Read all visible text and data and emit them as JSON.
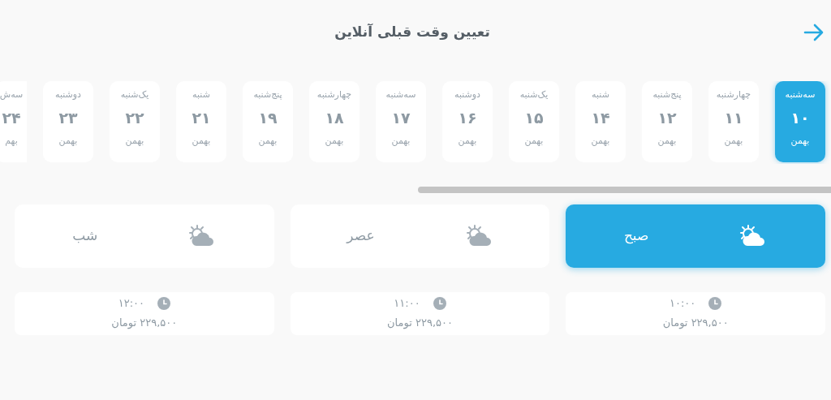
{
  "header": {
    "title": "تعیین وقت قبلی آنلاین"
  },
  "days": [
    {
      "weekday": "سه‌شنبه",
      "day": "۱۰",
      "month": "بهمن",
      "selected": true
    },
    {
      "weekday": "چهارشنبه",
      "day": "۱۱",
      "month": "بهمن",
      "selected": false
    },
    {
      "weekday": "پنج‌شنبه",
      "day": "۱۲",
      "month": "بهمن",
      "selected": false
    },
    {
      "weekday": "شنبه",
      "day": "۱۴",
      "month": "بهمن",
      "selected": false
    },
    {
      "weekday": "یک‌شنبه",
      "day": "۱۵",
      "month": "بهمن",
      "selected": false
    },
    {
      "weekday": "دوشنبه",
      "day": "۱۶",
      "month": "بهمن",
      "selected": false
    },
    {
      "weekday": "سه‌شنبه",
      "day": "۱۷",
      "month": "بهمن",
      "selected": false
    },
    {
      "weekday": "چهارشنبه",
      "day": "۱۸",
      "month": "بهمن",
      "selected": false
    },
    {
      "weekday": "پنج‌شنبه",
      "day": "۱۹",
      "month": "بهمن",
      "selected": false
    },
    {
      "weekday": "شنبه",
      "day": "۲۱",
      "month": "بهمن",
      "selected": false
    },
    {
      "weekday": "یک‌شنبه",
      "day": "۲۲",
      "month": "بهمن",
      "selected": false
    },
    {
      "weekday": "دوشنبه",
      "day": "۲۳",
      "month": "بهمن",
      "selected": false
    },
    {
      "weekday": "سه‌ش",
      "day": "۲۴",
      "month": "بهم",
      "selected": false
    }
  ],
  "periods": [
    {
      "label": "صبح",
      "selected": true
    },
    {
      "label": "عصر",
      "selected": false
    },
    {
      "label": "شب",
      "selected": false
    }
  ],
  "slots": [
    {
      "time": "۱۰:۰۰",
      "price": "۲۲۹,۵۰۰ تومان"
    },
    {
      "time": "۱۱:۰۰",
      "price": "۲۲۹,۵۰۰ تومان"
    },
    {
      "time": "۱۲:۰۰",
      "price": "۲۲۹,۵۰۰ تومان"
    }
  ]
}
